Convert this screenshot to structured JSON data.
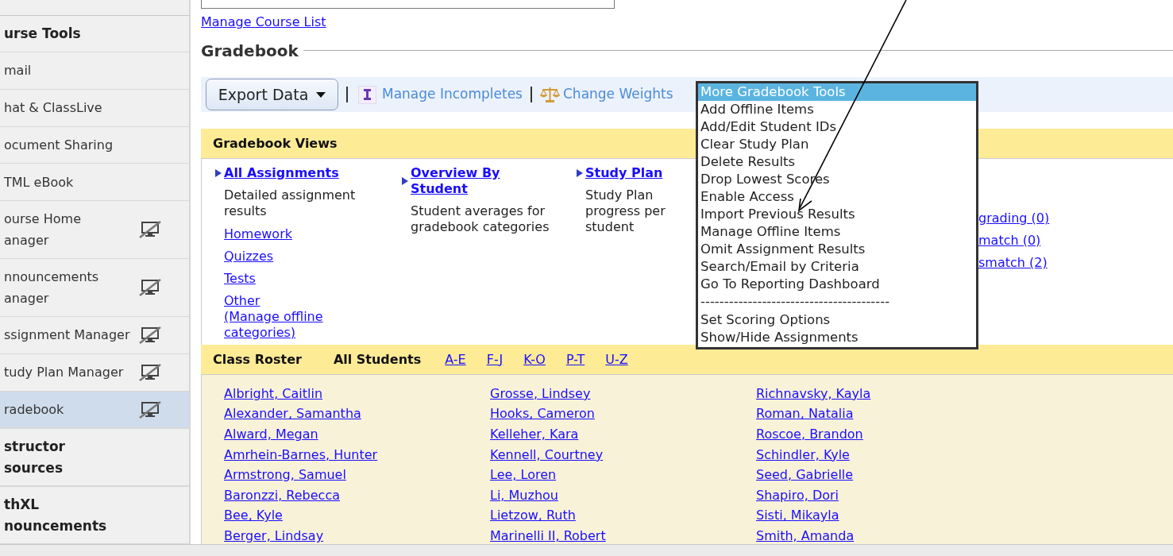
{
  "sidebar": {
    "items": [
      {
        "kind": "header",
        "label": "urse Tools"
      },
      {
        "kind": "tool",
        "label": "mail",
        "hidden": false,
        "selected": false
      },
      {
        "kind": "tool",
        "label": "hat & ClassLive",
        "hidden": false,
        "selected": false
      },
      {
        "kind": "tool",
        "label": "ocument Sharing",
        "hidden": false,
        "selected": false
      },
      {
        "kind": "tool",
        "label": "TML eBook",
        "hidden": false,
        "selected": false
      },
      {
        "kind": "tool",
        "label": "ourse Home\nanager",
        "hidden": true,
        "selected": false
      },
      {
        "kind": "tool",
        "label": "nnouncements\nanager",
        "hidden": true,
        "selected": false
      },
      {
        "kind": "tool",
        "label": "ssignment Manager",
        "hidden": true,
        "selected": false
      },
      {
        "kind": "tool",
        "label": "tudy Plan Manager",
        "hidden": true,
        "selected": false
      },
      {
        "kind": "tool",
        "label": "radebook",
        "hidden": true,
        "selected": true
      },
      {
        "kind": "header",
        "label": "structor\nsources"
      },
      {
        "kind": "header",
        "label": "thXL\nnouncements"
      }
    ]
  },
  "manage_course_list_link": "Manage Course List",
  "page_title": "Gradebook",
  "toolbar": {
    "export_button": "Export Data",
    "manage_incompletes": "Manage Incompletes",
    "change_weights": "Change Weights"
  },
  "gradebook_views": {
    "title": "Gradebook Views",
    "columns": [
      {
        "title": "All Assignments",
        "description": "Detailed assignment results",
        "links": [
          "Homework",
          "Quizzes",
          "Tests",
          "Other\n(Manage offline\ncategories)"
        ]
      },
      {
        "title": "Overview By\nStudent",
        "description": "Student averages for gradebook categories"
      },
      {
        "title": "Study Plan",
        "description": "Study Plan progress per student"
      }
    ],
    "partial_links": [
      "grading (0)",
      "match (0)",
      "smatch (2)"
    ]
  },
  "dropdown": {
    "items": [
      {
        "kind": "item",
        "label": "More Gradebook Tools",
        "selected": true
      },
      {
        "kind": "item",
        "label": "Add Offline Items",
        "selected": false
      },
      {
        "kind": "item",
        "label": "Add/Edit Student IDs",
        "selected": false
      },
      {
        "kind": "item",
        "label": "Clear Study Plan",
        "selected": false
      },
      {
        "kind": "item",
        "label": "Delete Results",
        "selected": false
      },
      {
        "kind": "item",
        "label": "Drop Lowest Scores",
        "selected": false
      },
      {
        "kind": "item",
        "label": "Enable Access",
        "selected": false
      },
      {
        "kind": "item",
        "label": "Import Previous Results",
        "selected": false
      },
      {
        "kind": "item",
        "label": "Manage Offline Items",
        "selected": false
      },
      {
        "kind": "item",
        "label": "Omit Assignment Results",
        "selected": false
      },
      {
        "kind": "item",
        "label": "Search/Email by Criteria",
        "selected": false
      },
      {
        "kind": "item",
        "label": "Go To Reporting Dashboard",
        "selected": false
      },
      {
        "kind": "separator",
        "label": "----------------------------------------"
      },
      {
        "kind": "item",
        "label": "Set Scoring Options",
        "selected": false
      },
      {
        "kind": "item",
        "label": "Show/Hide Assignments",
        "selected": false
      }
    ]
  },
  "class_roster": {
    "title": "Class Roster",
    "filters": [
      {
        "label": "All Students",
        "selected": true
      },
      {
        "label": "A-E",
        "selected": false
      },
      {
        "label": "F-J",
        "selected": false
      },
      {
        "label": "K-O",
        "selected": false
      },
      {
        "label": "P-T",
        "selected": false
      },
      {
        "label": "U-Z",
        "selected": false
      }
    ],
    "columns": [
      [
        "Albright, Caitlin",
        "Alexander, Samantha",
        "Alward, Megan",
        "Amrhein-Barnes, Hunter",
        "Armstrong, Samuel",
        "Baronzzi, Rebecca",
        "Bee, Kyle",
        "Berger, Lindsay"
      ],
      [
        "Grosse, Lindsey",
        "Hooks, Cameron",
        "Kelleher, Kara",
        "Kennell, Courtney",
        "Lee, Loren",
        "Li, Muzhou",
        "Lietzow, Ruth",
        "Marinelli II, Robert"
      ],
      [
        "Richnavsky, Kayla",
        "Roman, Natalia",
        "Roscoe, Brandon",
        "Schindler, Kyle",
        "Seed, Gabrielle",
        "Shapiro, Dori",
        "Sisti, Mikayla",
        "Smith, Amanda"
      ]
    ]
  }
}
